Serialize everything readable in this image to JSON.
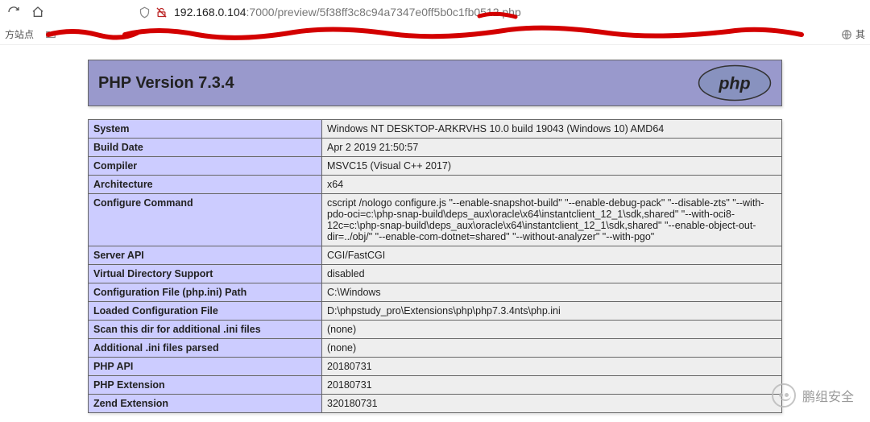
{
  "browser": {
    "url_host": "192.168.0.104",
    "url_rest": ":7000/preview/5f38ff3c8c94a7347e0ff5b0c1fb0512.php"
  },
  "bookmarks": {
    "first": "方站点",
    "globe_label": "其"
  },
  "header": {
    "title": "PHP Version 7.3.4"
  },
  "rows": [
    {
      "k": "System",
      "v": "Windows NT DESKTOP-ARKRVHS 10.0 build 19043 (Windows 10) AMD64"
    },
    {
      "k": "Build Date",
      "v": "Apr 2 2019 21:50:57"
    },
    {
      "k": "Compiler",
      "v": "MSVC15 (Visual C++ 2017)"
    },
    {
      "k": "Architecture",
      "v": "x64"
    },
    {
      "k": "Configure Command",
      "v": "cscript /nologo configure.js \"--enable-snapshot-build\" \"--enable-debug-pack\" \"--disable-zts\" \"--with-pdo-oci=c:\\php-snap-build\\deps_aux\\oracle\\x64\\instantclient_12_1\\sdk,shared\" \"--with-oci8-12c=c:\\php-snap-build\\deps_aux\\oracle\\x64\\instantclient_12_1\\sdk,shared\" \"--enable-object-out-dir=../obj/\" \"--enable-com-dotnet=shared\" \"--without-analyzer\" \"--with-pgo\""
    },
    {
      "k": "Server API",
      "v": "CGI/FastCGI"
    },
    {
      "k": "Virtual Directory Support",
      "v": "disabled"
    },
    {
      "k": "Configuration File (php.ini) Path",
      "v": "C:\\Windows"
    },
    {
      "k": "Loaded Configuration File",
      "v": "D:\\phpstudy_pro\\Extensions\\php\\php7.3.4nts\\php.ini"
    },
    {
      "k": "Scan this dir for additional .ini files",
      "v": "(none)"
    },
    {
      "k": "Additional .ini files parsed",
      "v": "(none)"
    },
    {
      "k": "PHP API",
      "v": "20180731"
    },
    {
      "k": "PHP Extension",
      "v": "20180731"
    },
    {
      "k": "Zend Extension",
      "v": "320180731"
    }
  ],
  "watermark": {
    "text": "鹏组安全"
  }
}
